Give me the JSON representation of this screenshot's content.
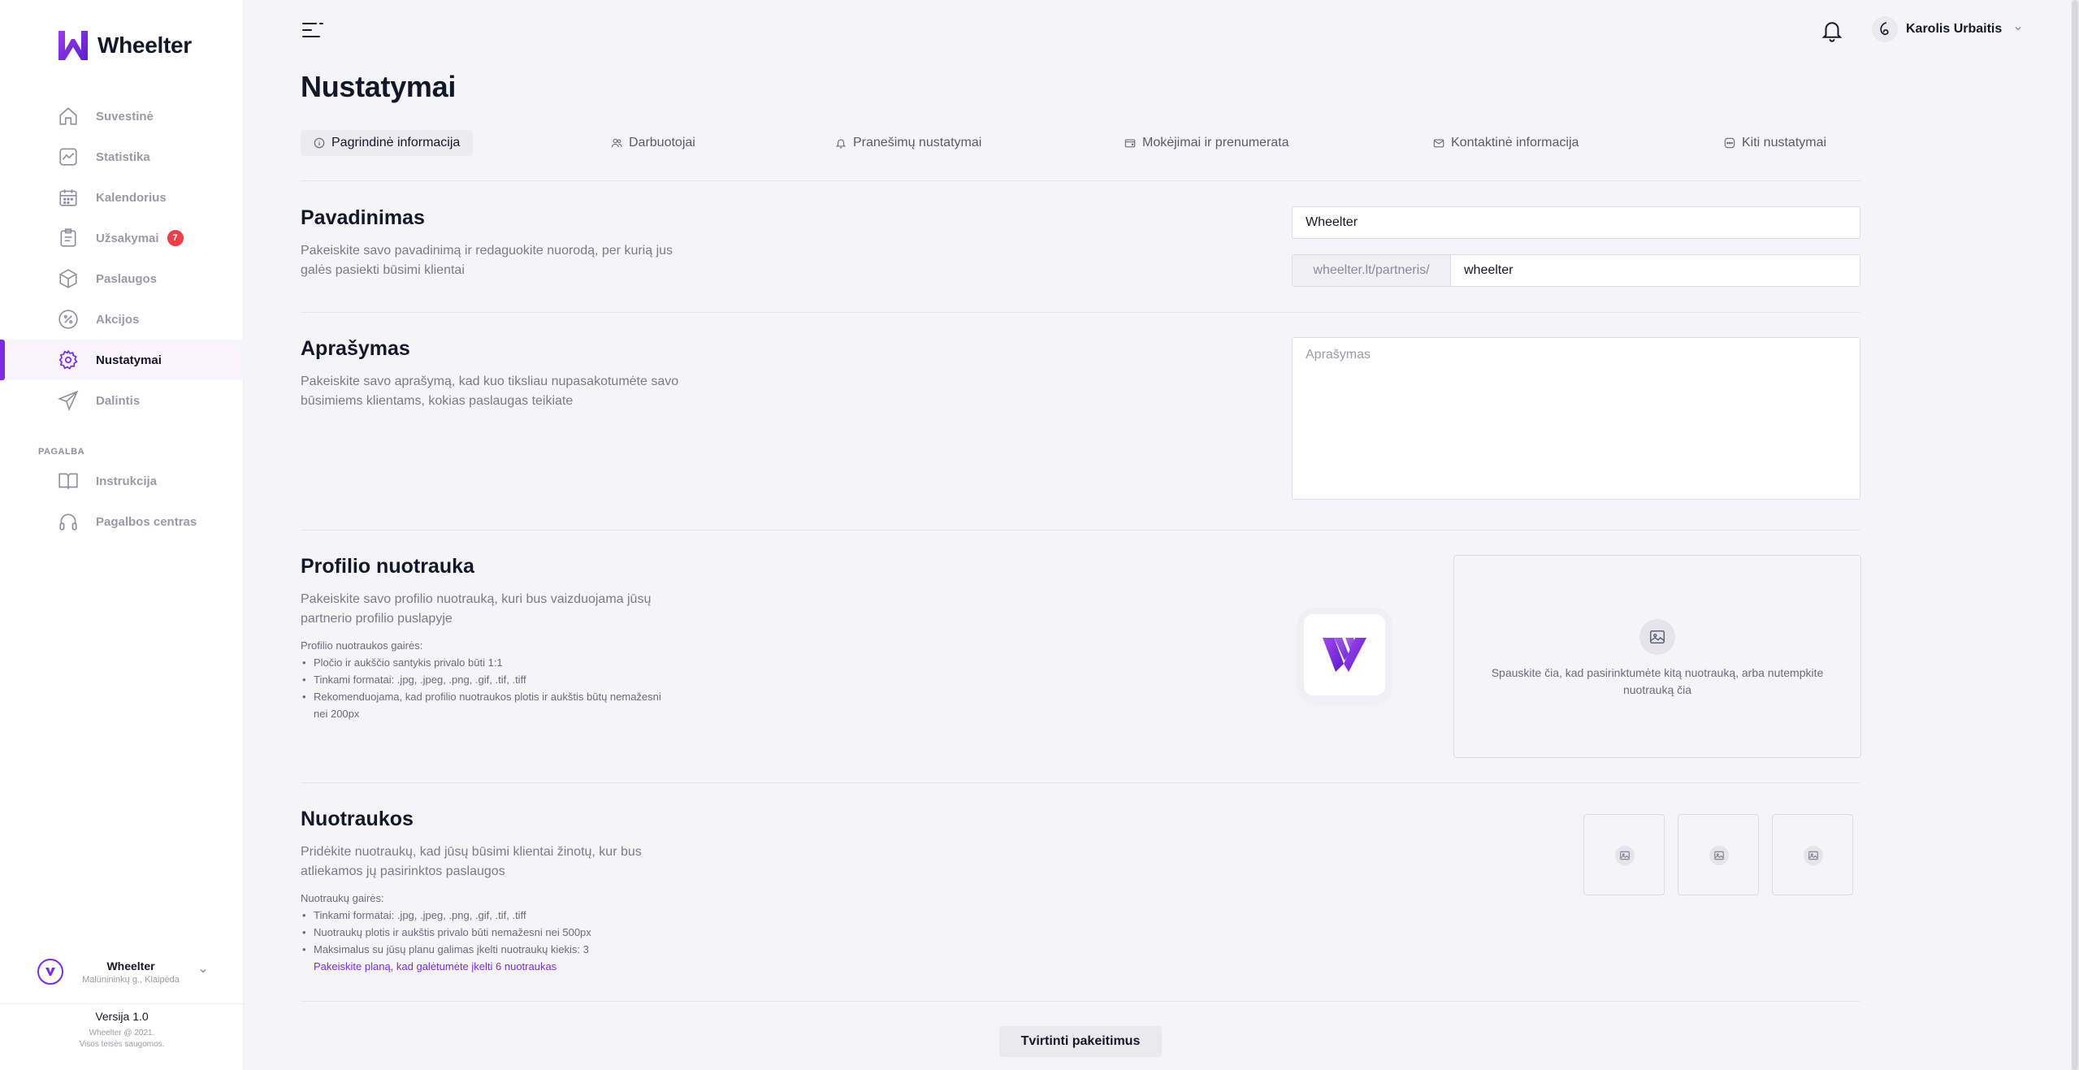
{
  "app": {
    "logo_text": "Wheelter"
  },
  "sidebar": {
    "items": [
      {
        "label": "Suvestinė",
        "icon": "home-icon"
      },
      {
        "label": "Statistika",
        "icon": "chart-icon"
      },
      {
        "label": "Kalendorius",
        "icon": "calendar-icon"
      },
      {
        "label": "Užsakymai",
        "icon": "orders-icon",
        "badge": "7"
      },
      {
        "label": "Paslaugos",
        "icon": "box-icon"
      },
      {
        "label": "Akcijos",
        "icon": "percent-icon"
      },
      {
        "label": "Nustatymai",
        "icon": "gear-icon",
        "active": true
      },
      {
        "label": "Dalintis",
        "icon": "send-icon"
      }
    ],
    "help_label": "PAGALBA",
    "help_items": [
      {
        "label": "Instrukcija",
        "icon": "book-icon"
      },
      {
        "label": "Pagalbos centras",
        "icon": "headset-icon"
      }
    ],
    "business": {
      "name": "Wheelter",
      "address": "Malūnininkų g., Klaipėda"
    },
    "version": "Versija 1.0",
    "copyright_line1": "Wheelter @ 2021.",
    "copyright_line2": "Visos teisės saugomos."
  },
  "header": {
    "user_name": "Karolis Urbaitis"
  },
  "page": {
    "title": "Nustatymai",
    "tabs": [
      {
        "label": "Pagrindinė informacija",
        "icon": "info-icon",
        "active": true
      },
      {
        "label": "Darbuotojai",
        "icon": "users-icon"
      },
      {
        "label": "Pranešimų nustatymai",
        "icon": "bell-icon"
      },
      {
        "label": "Mokėjimai ir prenumerata",
        "icon": "wallet-icon"
      },
      {
        "label": "Kontaktinė informacija",
        "icon": "mail-icon"
      },
      {
        "label": "Kiti nustatymai",
        "icon": "more-icon"
      }
    ]
  },
  "name_section": {
    "title": "Pavadinimas",
    "description": "Pakeiskite savo pavadinimą ir redaguokite nuorodą, per kurią jus galės pasiekti būsimi klientai",
    "name_value": "Wheelter",
    "url_prefix": "wheelter.lt/partneris/",
    "slug_value": "wheelter"
  },
  "description_section": {
    "title": "Aprašymas",
    "description": "Pakeiskite savo aprašymą, kad kuo tiksliau nupasakotumėte savo būsimiems klientams, kokias paslaugas teikiate",
    "placeholder": "Aprašymas"
  },
  "profile_section": {
    "title": "Profilio nuotrauka",
    "description": "Pakeiskite savo profilio nuotrauką, kuri bus vaizduojama jūsų partnerio profilio puslapyje",
    "guide_title": "Profilio nuotraukos gairės:",
    "guide": [
      "Pločio ir aukščio santykis privalo būti 1:1",
      "Tinkami formatai: .jpg, .jpeg, .png, .gif, .tif, .tiff",
      "Rekomenduojama, kad profilio nuotraukos plotis ir aukštis būtų nemažesni nei 200px"
    ],
    "dropzone_text": "Spauskite čia, kad pasirinktumėte kitą nuotrauką, arba nutempkite nuotrauką čia"
  },
  "photos_section": {
    "title": "Nuotraukos",
    "description": "Pridėkite nuotraukų, kad jūsų būsimi klientai žinotų, kur bus atliekamos jų pasirinktos paslaugos",
    "guide_title": "Nuotraukų gairės:",
    "guide": [
      "Tinkami formatai: .jpg, .jpeg, .png, .gif, .tif, .tiff",
      "Nuotraukų plotis ir aukštis privalo būti nemažesni nei 500px",
      "Maksimalus su jūsų planu galimas įkelti nuotraukų kiekis: 3"
    ],
    "upgrade_link": "Pakeiskite planą, kad galėtumėte įkelti 6 nuotraukas"
  },
  "actions": {
    "submit_label": "Tvirtinti pakeitimus"
  },
  "colors": {
    "accent": "#7c2ae8",
    "badge": "#ef3e4a"
  }
}
